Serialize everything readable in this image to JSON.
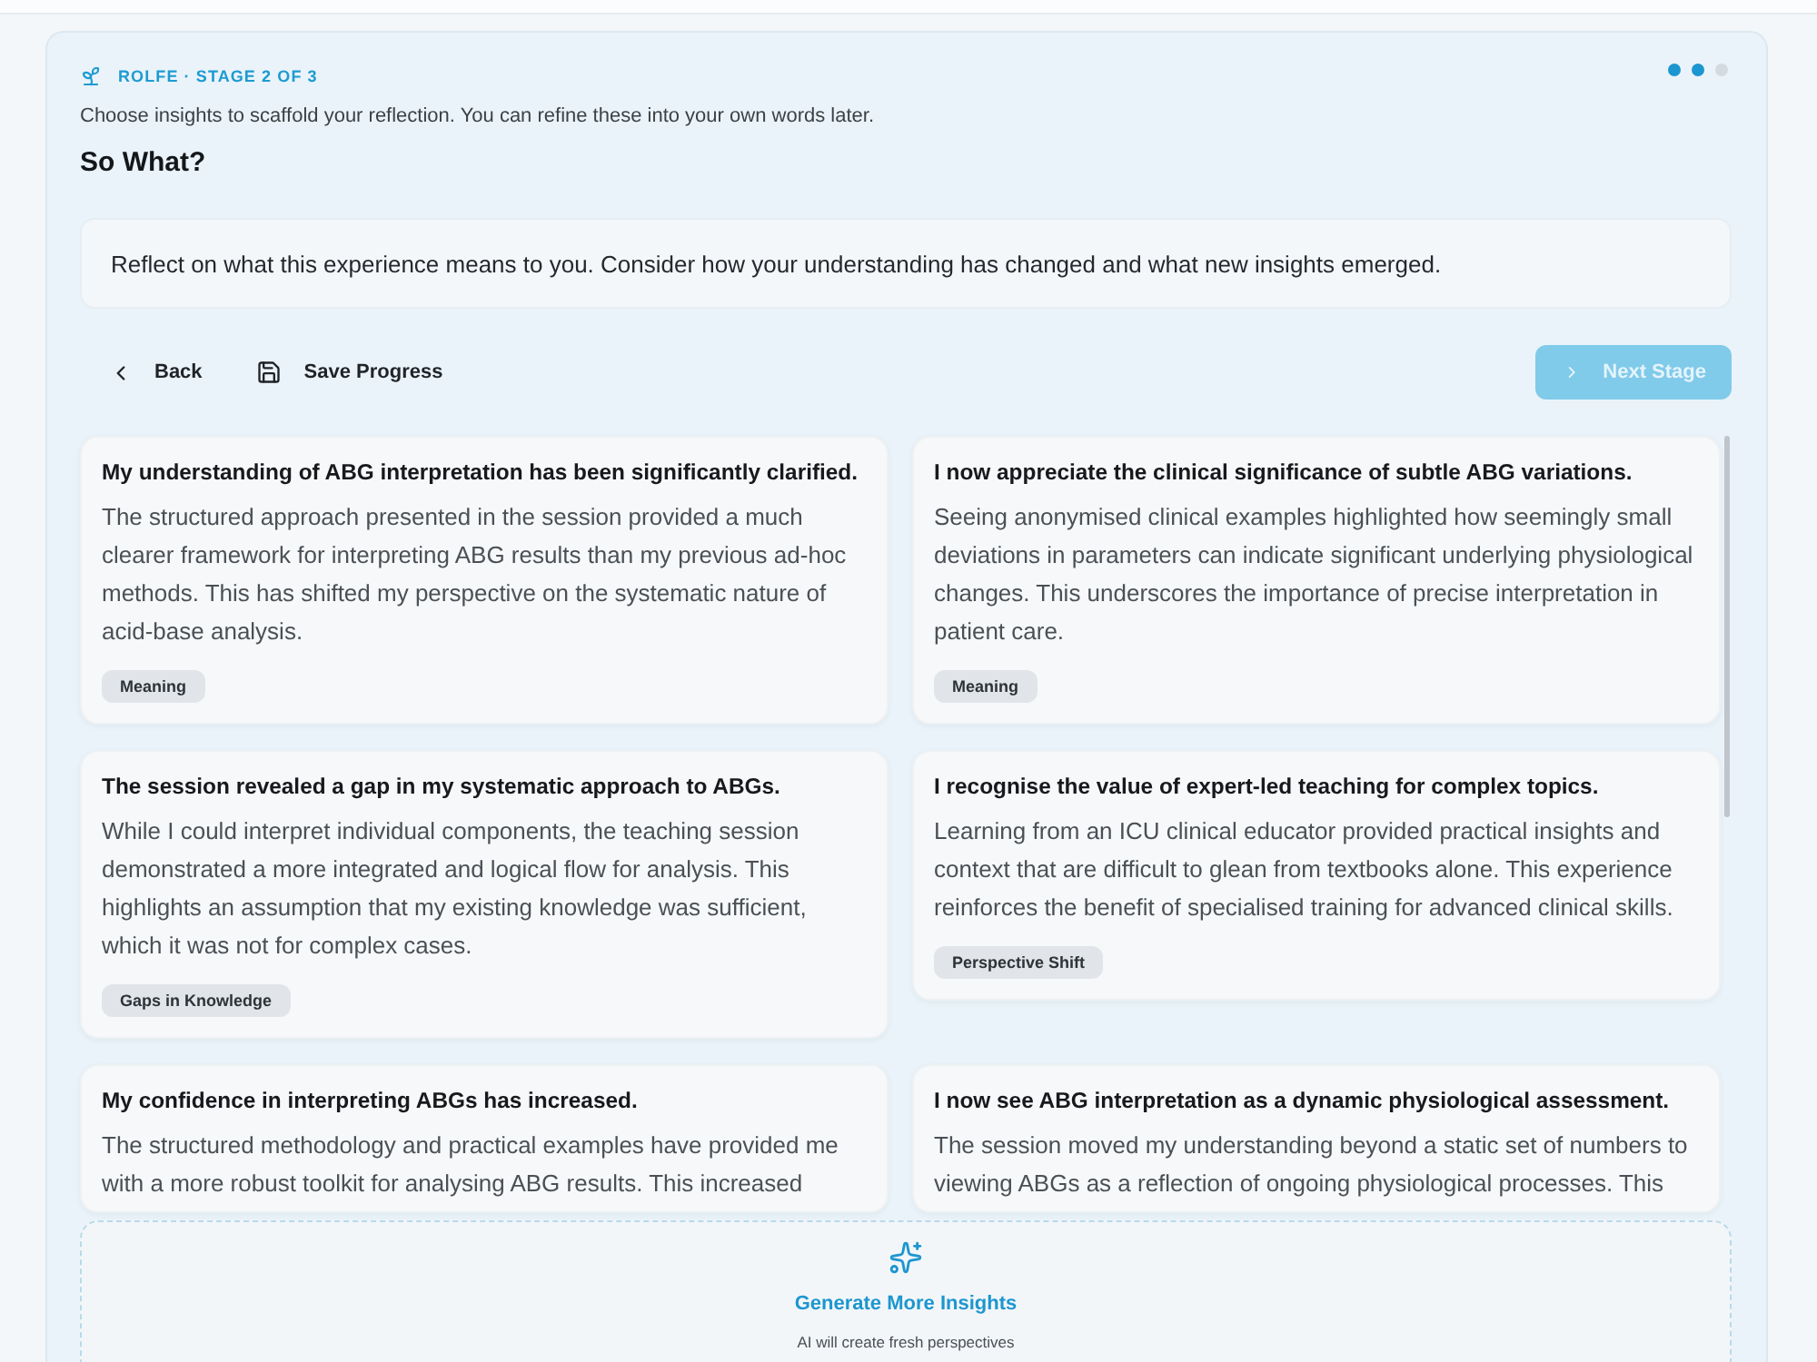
{
  "header": {
    "eyebrow": "ROLFE · STAGE 2 OF 3",
    "subtitle": "Choose insights to scaffold your reflection. You can refine these into your own words later.",
    "title": "So What?",
    "stage_dots": [
      {
        "active": true
      },
      {
        "active": true
      },
      {
        "active": false
      }
    ]
  },
  "prompt": "Reflect on what this experience means to you. Consider how your understanding has changed and what new insights emerged.",
  "toolbar": {
    "back": "Back",
    "save": "Save Progress",
    "next": {
      "label": "Next Stage",
      "disabled": true
    }
  },
  "insights": [
    {
      "title": "My understanding of ABG interpretation has been significantly clarified.",
      "body": "The structured approach presented in the session provided a much clearer framework for interpreting ABG results than my previous ad-hoc methods. This has shifted my perspective on the systematic nature of acid-base analysis.",
      "tag": "Meaning",
      "selected": false
    },
    {
      "title": "I now appreciate the clinical significance of subtle ABG variations.",
      "body": "Seeing anonymised clinical examples highlighted how seemingly small deviations in parameters can indicate significant underlying physiological changes. This underscores the importance of precise interpretation in patient care.",
      "tag": "Meaning",
      "selected": false
    },
    {
      "title": "The session revealed a gap in my systematic approach to ABGs.",
      "body": "While I could interpret individual components, the teaching session demonstrated a more integrated and logical flow for analysis. This highlights an assumption that my existing knowledge was sufficient, which it was not for complex cases.",
      "tag": "Gaps in Knowledge",
      "selected": false
    },
    {
      "title": "I recognise the value of expert-led teaching for complex topics.",
      "body": "Learning from an ICU clinical educator provided practical insights and context that are difficult to glean from textbooks alone. This experience reinforces the benefit of specialised training for advanced clinical skills.",
      "tag": "Perspective Shift",
      "selected": false
    },
    {
      "title": "My confidence in interpreting ABGs has increased.",
      "body": "The structured methodology and practical examples have provided me with a more robust toolkit for analysing ABG results. This increased",
      "selected": false
    },
    {
      "title": "I now see ABG interpretation as a dynamic physiological assessment.",
      "body": "The session moved my understanding beyond a static set of numbers to viewing ABGs as a reflection of ongoing physiological processes. This",
      "selected": false
    }
  ],
  "generate": {
    "label": "Generate More Insights",
    "hint": "AI will create fresh perspectives"
  }
}
